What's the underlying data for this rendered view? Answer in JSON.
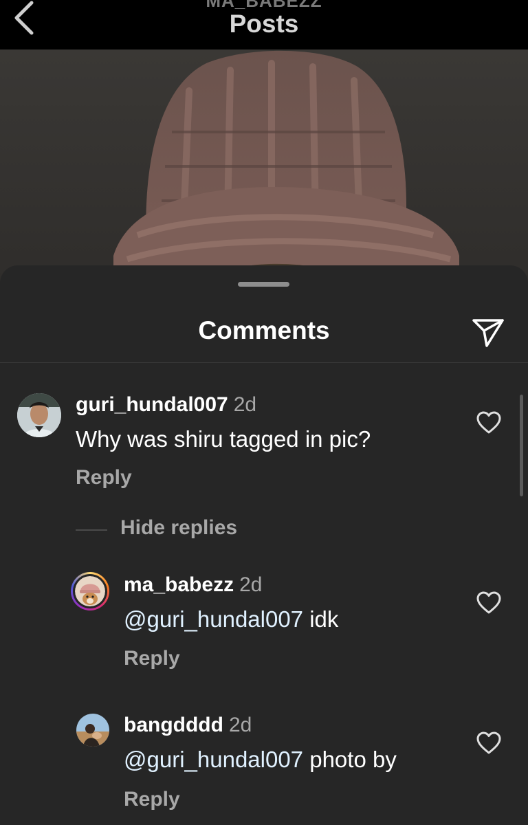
{
  "header": {
    "username": "MA_BABEZZ",
    "title": "Posts"
  },
  "sheet": {
    "title": "Comments"
  },
  "comments": [
    {
      "username": "guri_hundal007",
      "time": "2d",
      "text": "Why was shiru tagged in pic?",
      "reply_label": "Reply"
    }
  ],
  "thread": {
    "hide_replies_label": "Hide replies"
  },
  "replies": [
    {
      "username": "ma_babezz",
      "time": "2d",
      "mention": "@guri_hundal007",
      "text": " idk",
      "reply_label": "Reply"
    },
    {
      "username": "bangdddd",
      "time": "2d",
      "mention": "@guri_hundal007",
      "text": " photo by",
      "reply_label": "Reply"
    }
  ],
  "colors": {
    "background": "#262626",
    "topbar": "#000000",
    "secondary_text": "#a8a8a8",
    "story_ring": "#d6249f"
  },
  "icons": {
    "back": "chevron-left-icon",
    "share": "paper-plane-icon",
    "like": "heart-outline-icon"
  }
}
